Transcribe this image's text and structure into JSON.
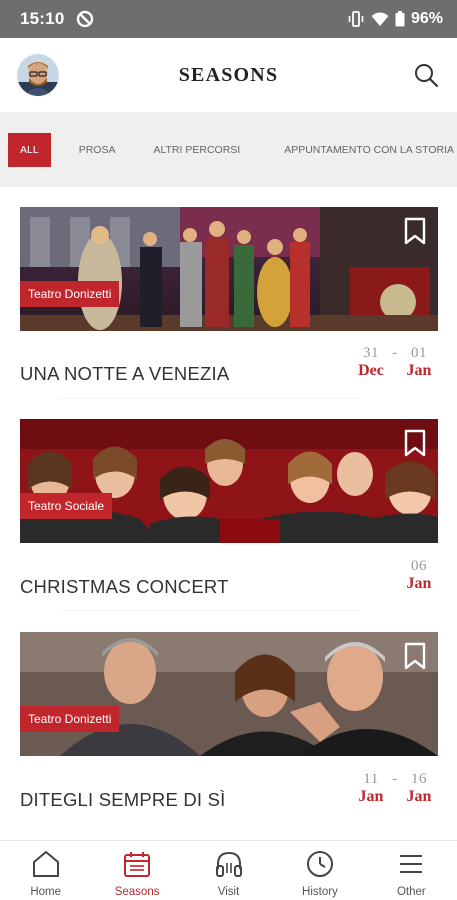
{
  "status_bar": {
    "time": "15:10",
    "battery": "96%"
  },
  "header": {
    "title": "SEASONS"
  },
  "filters": [
    "ALL",
    "PROSA",
    "ALTRI PERCORSI",
    "APPUNTAMENTO CON LA STORIA"
  ],
  "events": [
    {
      "venue": "Teatro Donizetti",
      "title": "UNA NOTTE A VENEZIA",
      "start_day": "31",
      "start_month": "Dec",
      "end_day": "01",
      "end_month": "Jan"
    },
    {
      "venue": "Teatro Sociale",
      "title": "CHRISTMAS CONCERT",
      "start_day": "06",
      "start_month": "Jan"
    },
    {
      "venue": "Teatro Donizetti",
      "title": "DITEGLI SEMPRE DI SÌ",
      "start_day": "11",
      "start_month": "Jan",
      "end_day": "16",
      "end_month": "Jan"
    }
  ],
  "nav": [
    {
      "label": "Home",
      "icon": "home-icon"
    },
    {
      "label": "Seasons",
      "icon": "calendar-icon",
      "active": true
    },
    {
      "label": "Visit",
      "icon": "headphones-icon"
    },
    {
      "label": "History",
      "icon": "clock-icon"
    },
    {
      "label": "Other",
      "icon": "menu-icon"
    }
  ],
  "colors": {
    "accent": "#c0262c",
    "statusbar": "#6e6e6e",
    "filterbar": "#efefef"
  }
}
